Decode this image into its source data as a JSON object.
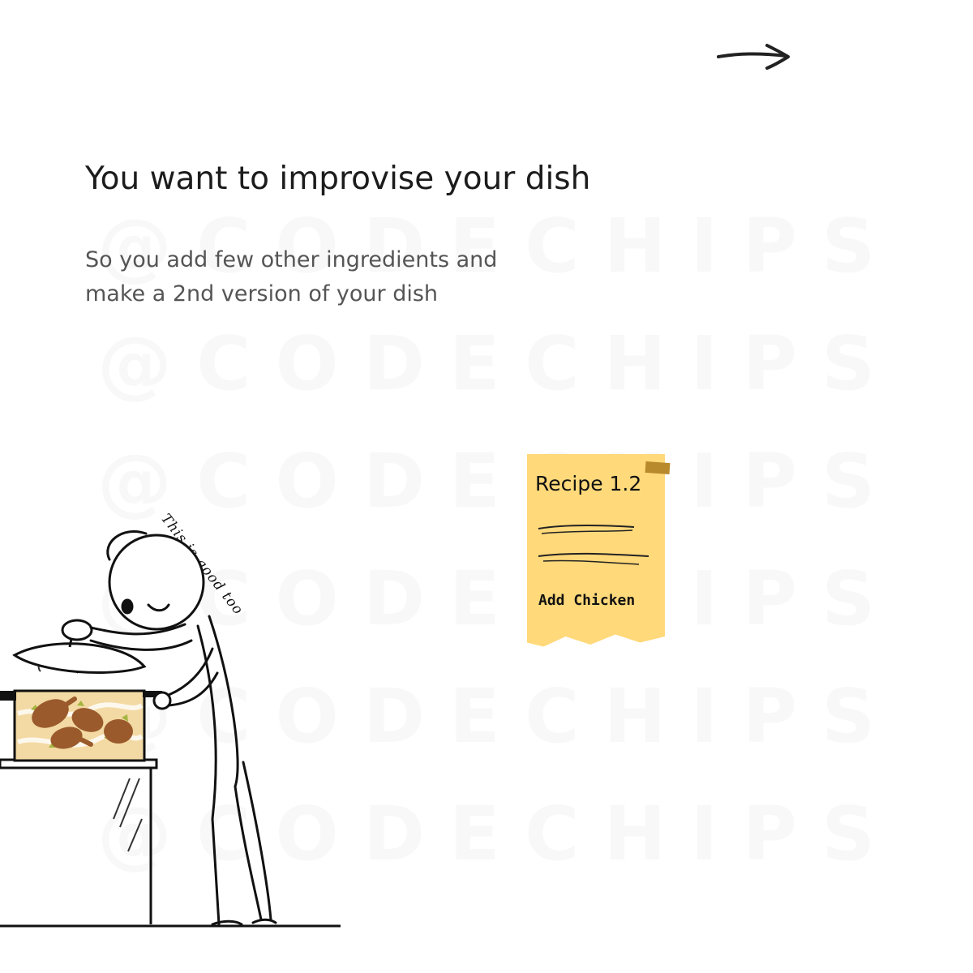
{
  "navigation": {
    "next_icon": "right-arrow-icon"
  },
  "slide": {
    "headline": "You want to improvise your dish",
    "body_lines": [
      "So you add few other ingredients and",
      "make a 2nd version of your dish"
    ]
  },
  "illustration": {
    "speech": "This is good too",
    "icons": [
      "stick-figure-icon",
      "cooking-pot-icon",
      "chicken-leg-icon",
      "pot-lid-icon",
      "kitchen-counter-icon"
    ]
  },
  "recipe_note": {
    "title": "Recipe 1.2",
    "line": "Add Chicken"
  },
  "watermark": {
    "text": "@CODECHIPS"
  },
  "colors": {
    "note": "#ffd97a",
    "tape": "#b88a2c",
    "soup": "#f3d9a3",
    "chicken": "#9a5a2c",
    "herb": "#a4b640"
  }
}
